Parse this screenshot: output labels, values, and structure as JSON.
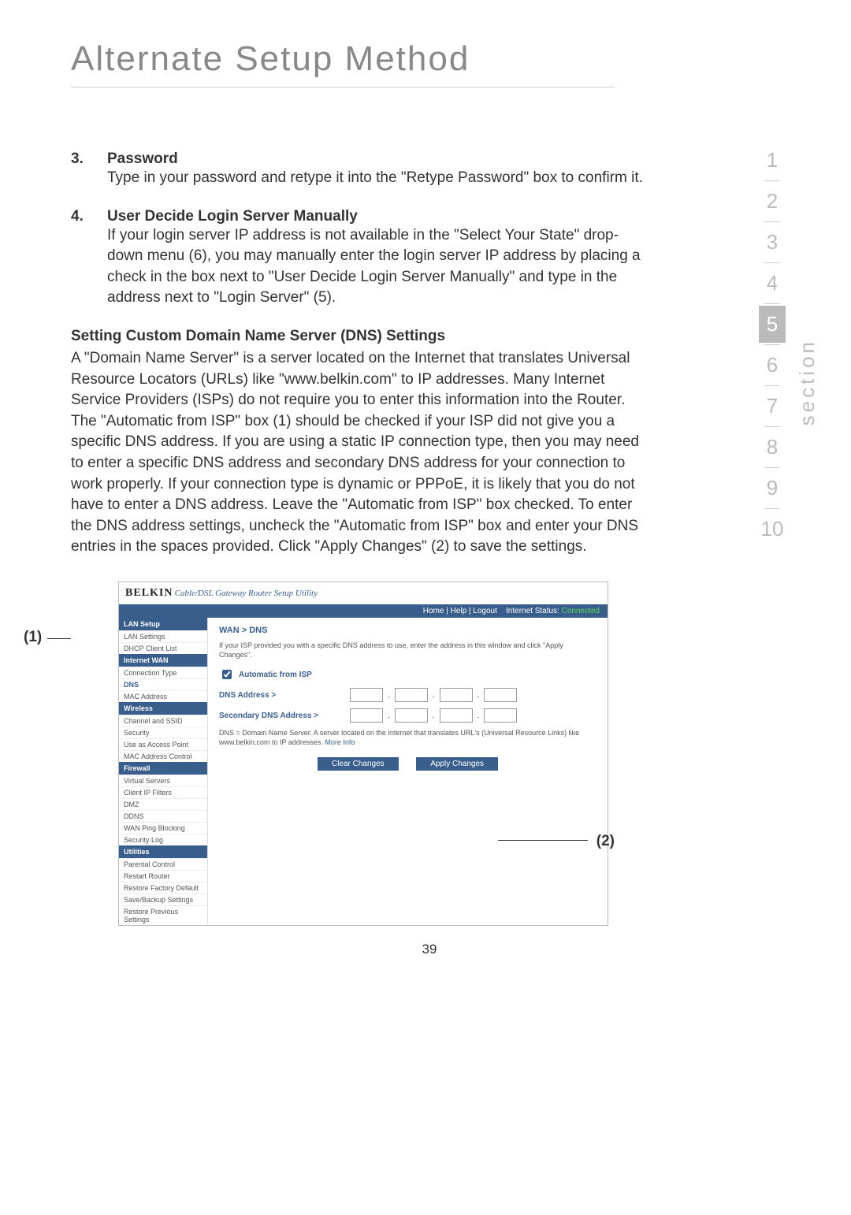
{
  "page_title": "Alternate Setup Method",
  "page_number": "39",
  "step3": {
    "num": "3.",
    "title": "Password",
    "body": "Type in your password and retype it into the \"Retype Password\" box to confirm it."
  },
  "step4": {
    "num": "4.",
    "title": "User Decide Login Server Manually",
    "body": "If your login server IP address is not available in the \"Select Your State\" drop-down menu (6), you may manually enter the login server IP address by placing a check in the box next to \"User Decide Login Server Manually\" and type in the address next to \"Login Server\" (5)."
  },
  "dns_section": {
    "heading": "Setting Custom Domain Name Server (DNS) Settings",
    "body": "A \"Domain Name Server\" is a server located on the Internet that translates Universal Resource Locators (URLs) like \"www.belkin.com\" to IP addresses. Many Internet Service Providers (ISPs) do not require you to enter this information into the Router. The \"Automatic from ISP\" box (1) should be checked if your ISP did not give you a specific DNS address. If you are using a static IP connection type, then you may need to enter a specific DNS address and secondary DNS address for your connection to work properly. If your connection type is dynamic or PPPoE, it is likely that you do not have to enter a DNS address. Leave the \"Automatic from ISP\" box checked. To enter the DNS address settings, uncheck the \"Automatic from ISP\" box and enter your DNS entries in the spaces provided. Click \"Apply Changes\" (2) to save the settings."
  },
  "side_tabs": [
    "1",
    "2",
    "3",
    "4",
    "5",
    "6",
    "7",
    "8",
    "9",
    "10"
  ],
  "side_active": "5",
  "side_label": "section",
  "router": {
    "brand": "BELKIN",
    "brand_sub": "Cable/DSL Gateway Router Setup Utility",
    "topbar_links": "Home | Help | Logout",
    "topbar_status_label": "Internet Status:",
    "topbar_status_value": "Connected",
    "sidebar": {
      "lan_setup": "LAN Setup",
      "lan_settings": "LAN Settings",
      "dhcp_client_list": "DHCP Client List",
      "internet_wan": "Internet WAN",
      "connection_type": "Connection Type",
      "dns": "DNS",
      "mac_address": "MAC Address",
      "wireless": "Wireless",
      "channel_ssid": "Channel and SSID",
      "security": "Security",
      "use_as_ap": "Use as Access Point",
      "mac_addr_ctrl": "MAC Address Control",
      "firewall": "Firewall",
      "virtual_servers": "Virtual Servers",
      "client_ip_filters": "Client IP Filters",
      "dmz": "DMZ",
      "ddns": "DDNS",
      "wan_ping_blocking": "WAN Ping Blocking",
      "security_log": "Security Log",
      "utilities": "Utilities",
      "parental_control": "Parental Control",
      "restart_router": "Restart Router",
      "restore_factory": "Restore Factory Default",
      "save_backup": "Save/Backup Settings",
      "restore_previous": "Restore Previous Settings"
    },
    "breadcrumb": "WAN > DNS",
    "instruction": "If your ISP provided you with a specific DNS address to use, enter the address in this window and click \"Apply Changes\".",
    "auto_from_isp": "Automatic from ISP",
    "dns_address": "DNS Address >",
    "secondary_dns": "Secondary DNS Address >",
    "dns_note_1": "DNS = Domain Name Server. A server located on the Internet that translates URL's (Universal Resource Links) like www.belkin.com to IP addresses.",
    "more_info": "More Info",
    "clear_btn": "Clear Changes",
    "apply_btn": "Apply Changes"
  },
  "callouts": {
    "c1": "(1)",
    "c2": "(2)"
  }
}
